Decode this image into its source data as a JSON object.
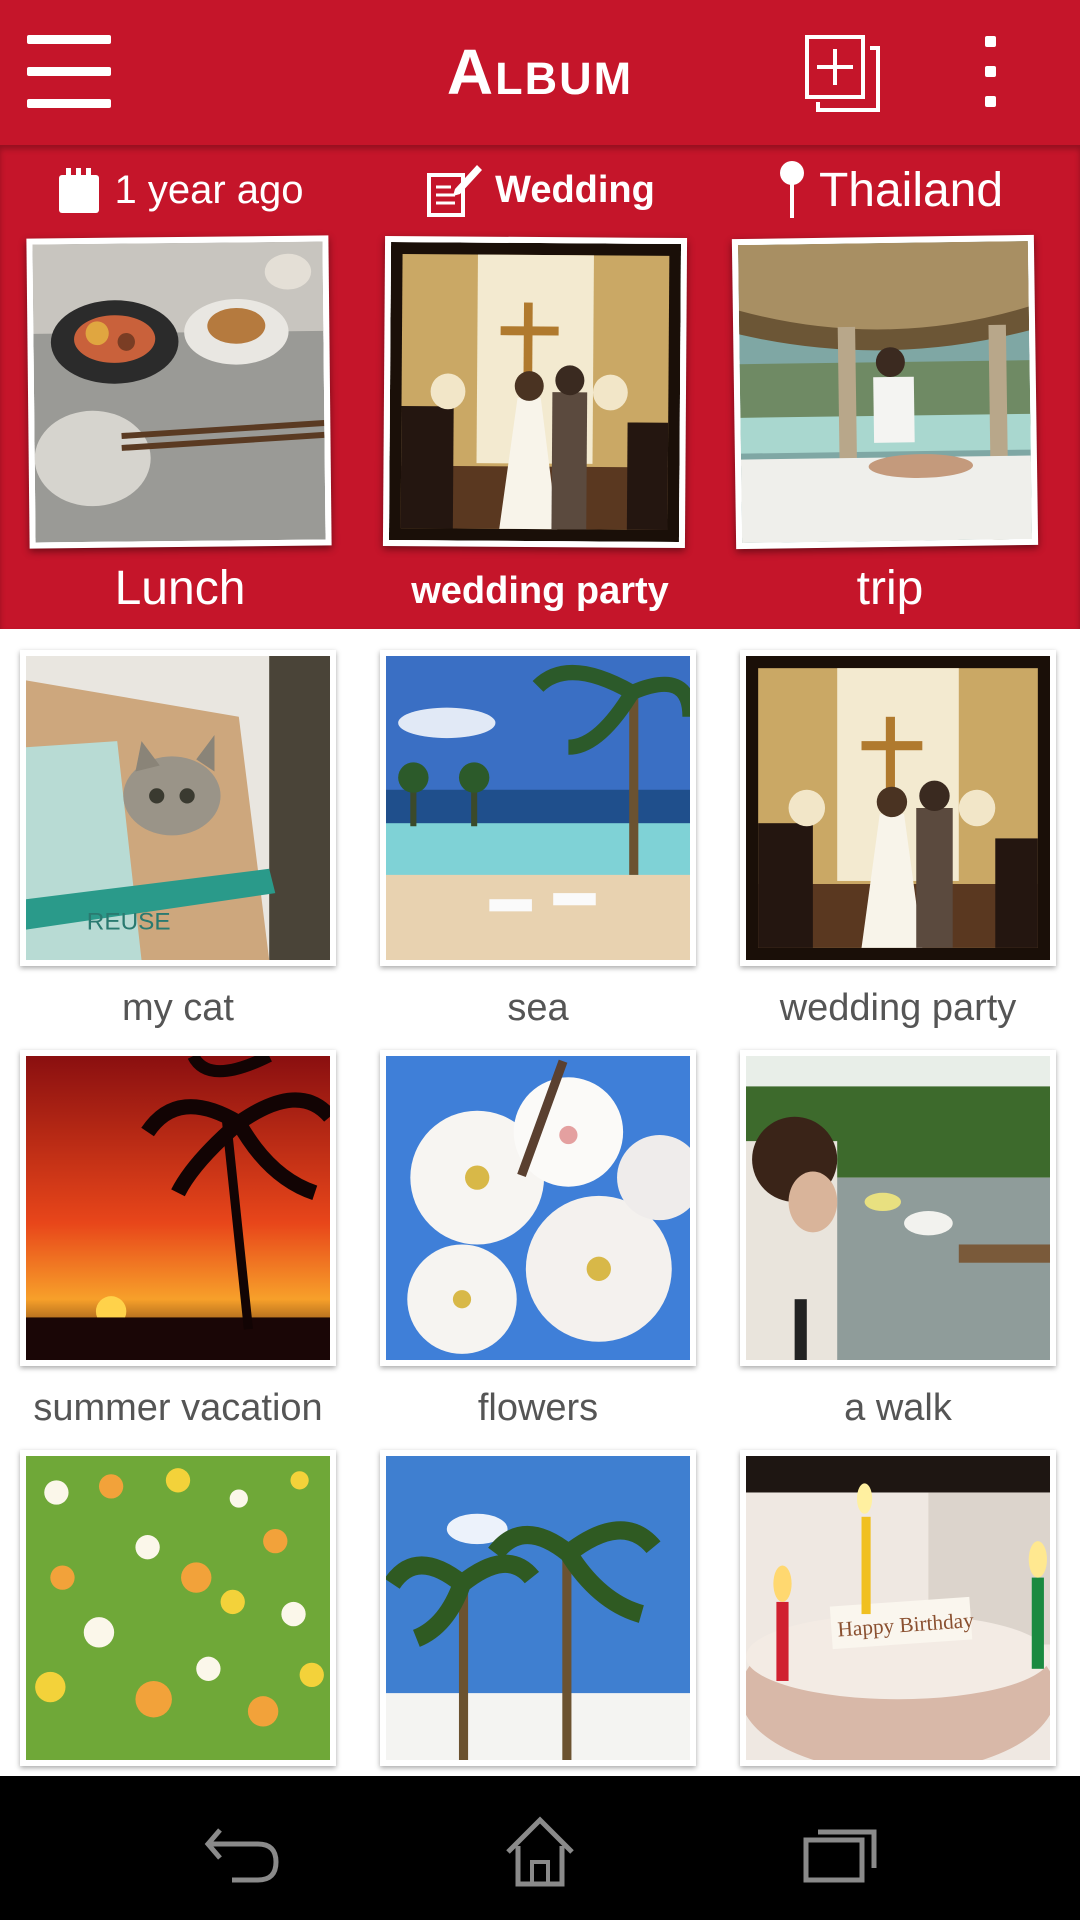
{
  "app": {
    "title": "Album",
    "accent_color": "#c5152a",
    "icons": {
      "menu": "hamburger-menu-icon",
      "add": "add-album-icon",
      "more": "more-vert-icon"
    }
  },
  "featured": [
    {
      "tag_icon": "calendar-icon",
      "tag": "1 year ago",
      "caption": "Lunch"
    },
    {
      "tag_icon": "note-edit-icon",
      "tag": "Wedding",
      "caption": "wedding party"
    },
    {
      "tag_icon": "pin-icon",
      "tag": "Thailand",
      "caption": "trip"
    }
  ],
  "albums": [
    {
      "label": "my cat"
    },
    {
      "label": "sea"
    },
    {
      "label": "wedding party"
    },
    {
      "label": "summer vacation"
    },
    {
      "label": "flowers"
    },
    {
      "label": "a walk"
    },
    {
      "label": ""
    },
    {
      "label": ""
    },
    {
      "label": ""
    }
  ],
  "cake_text": "Happy Birthday",
  "navbar": {
    "icons": [
      "back-icon",
      "home-icon",
      "recent-apps-icon"
    ]
  }
}
